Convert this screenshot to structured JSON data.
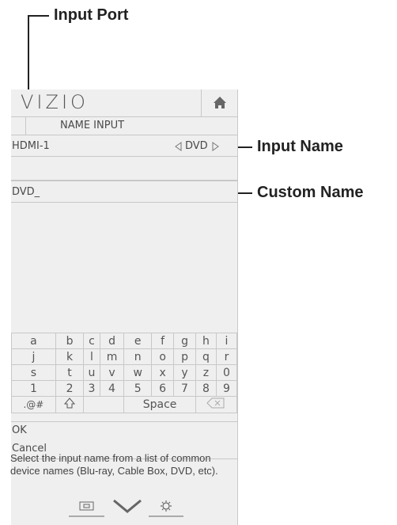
{
  "callouts": {
    "input_port": "Input Port",
    "input_name": "Input Name",
    "custom_name": "Custom Name"
  },
  "header": {
    "logo": "VIZIO",
    "title": "NAME INPUT",
    "home_icon": "home-icon"
  },
  "input_row": {
    "port": "HDMI-1",
    "name_value": "DVD",
    "left_arrow_icon": "arrow-left-icon",
    "right_arrow_icon": "arrow-right-icon"
  },
  "custom_field": {
    "value": "DVD_"
  },
  "keyboard": {
    "rows": [
      [
        "a",
        "b",
        "c",
        "d",
        "e",
        "f",
        "g",
        "h",
        "i"
      ],
      [
        "j",
        "k",
        "l",
        "m",
        "n",
        "o",
        "p",
        "q",
        "r"
      ],
      [
        "s",
        "t",
        "u",
        "v",
        "w",
        "x",
        "y",
        "z",
        "0"
      ],
      [
        "1",
        "2",
        "3",
        "4",
        "5",
        "6",
        "7",
        "8",
        "9"
      ]
    ],
    "symbols_key": ".@#",
    "shift_icon": "shift-icon",
    "space_key": "Space",
    "backspace_icon": "backspace-icon"
  },
  "menu": {
    "ok": "OK",
    "cancel": "Cancel"
  },
  "help_text": "Select the input name from a list of common device names (Blu-ray, Cable Box, DVD, etc).",
  "nav_icons": [
    "wide-icon",
    "chevron-down-icon",
    "settings-icon"
  ],
  "colors": {
    "panel": "#efefef",
    "border": "#c8c8c8",
    "text": "#4a4a4a",
    "callout": "#222222"
  }
}
